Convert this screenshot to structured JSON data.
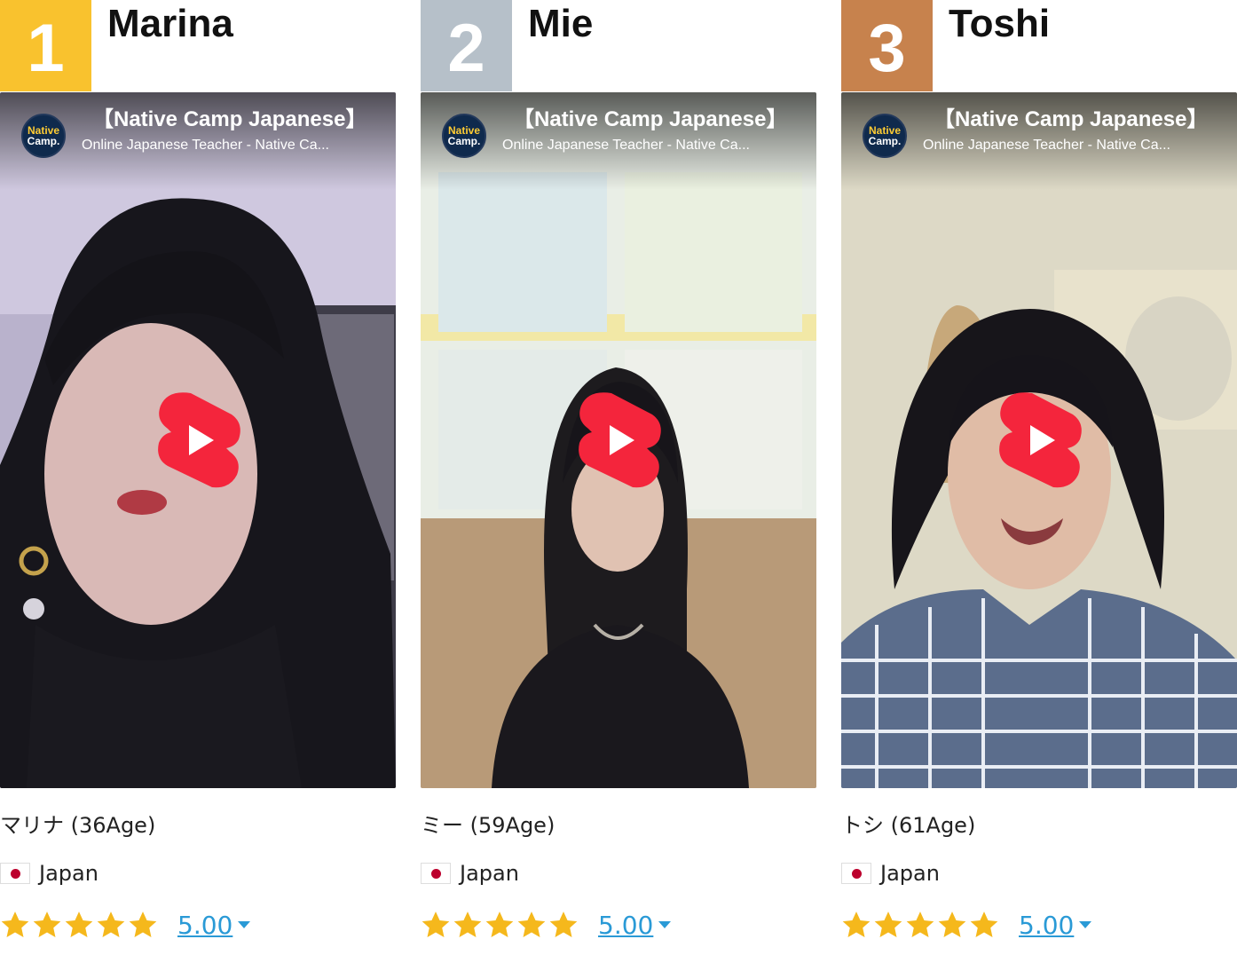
{
  "colors": {
    "rank_gold": "#f9c22e",
    "rank_silver": "#b6c0c9",
    "rank_bronze": "#c7824d",
    "star": "#f5b81c",
    "rating_link": "#2a9ad6",
    "play_red": "#f4253c"
  },
  "cards": [
    {
      "rank": "1",
      "name": "Marina",
      "video": {
        "logo_line1": "Native",
        "logo_line2": "Camp.",
        "title": "【Native Camp Japanese】",
        "subtitle": "Online Japanese Teacher - Native Ca..."
      },
      "meta": "マリナ (36Age)",
      "country": "Japan",
      "stars": 5,
      "rating": "5.00"
    },
    {
      "rank": "2",
      "name": "Mie",
      "video": {
        "logo_line1": "Native",
        "logo_line2": "Camp.",
        "title": "【Native Camp Japanese】",
        "subtitle": "Online Japanese Teacher - Native Ca..."
      },
      "meta": "ミー (59Age)",
      "country": "Japan",
      "stars": 5,
      "rating": "5.00"
    },
    {
      "rank": "3",
      "name": "Toshi",
      "video": {
        "logo_line1": "Native",
        "logo_line2": "Camp.",
        "title": "【Native Camp Japanese】",
        "subtitle": "Online Japanese Teacher - Native Ca..."
      },
      "meta": "トシ (61Age)",
      "country": "Japan",
      "stars": 5,
      "rating": "5.00"
    }
  ]
}
